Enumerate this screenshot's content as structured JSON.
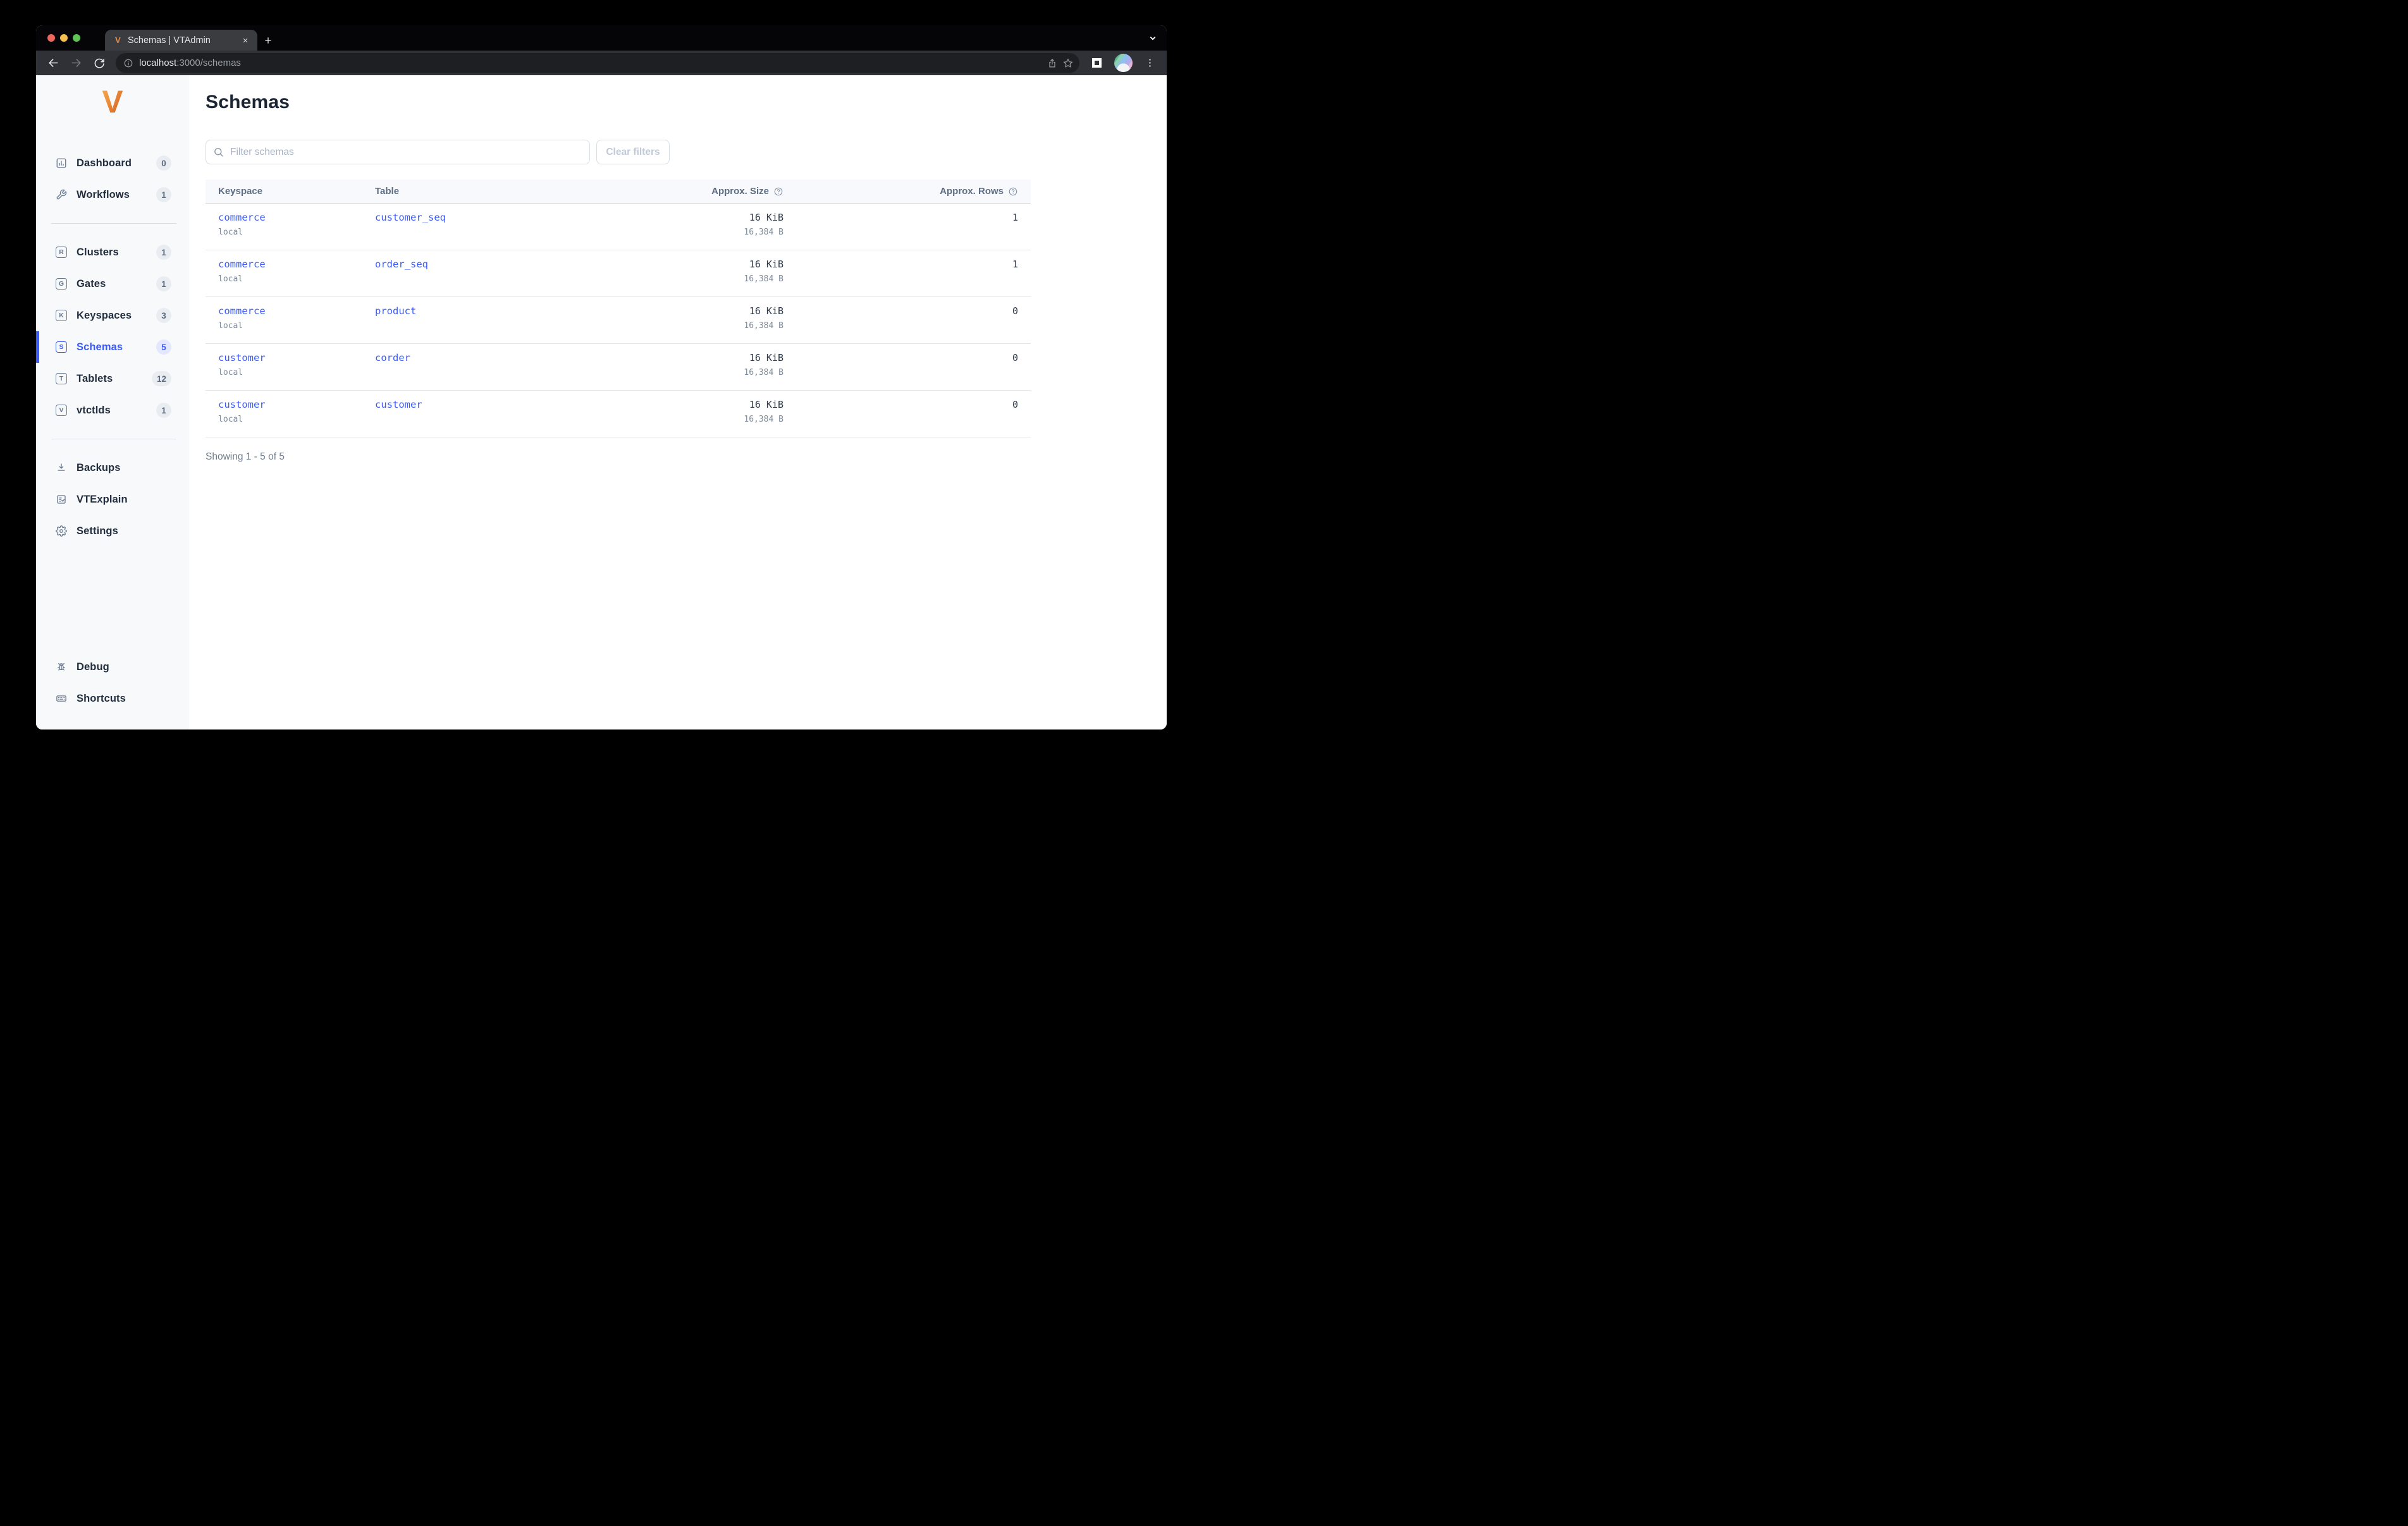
{
  "browser": {
    "tab_title": "Schemas | VTAdmin",
    "url_host": "localhost",
    "url_rest": ":3000/schemas"
  },
  "sidebar": {
    "nav": [
      {
        "label": "Dashboard",
        "badge": "0"
      },
      {
        "label": "Workflows",
        "badge": "1"
      },
      {
        "label": "Clusters",
        "badge": "1",
        "letter": "R"
      },
      {
        "label": "Gates",
        "badge": "1",
        "letter": "G"
      },
      {
        "label": "Keyspaces",
        "badge": "3",
        "letter": "K"
      },
      {
        "label": "Schemas",
        "badge": "5",
        "letter": "S"
      },
      {
        "label": "Tablets",
        "badge": "12",
        "letter": "T"
      },
      {
        "label": "vtctlds",
        "badge": "1",
        "letter": "V"
      }
    ],
    "secondary": [
      {
        "label": "Backups"
      },
      {
        "label": "VTExplain"
      },
      {
        "label": "Settings"
      }
    ],
    "bottom": [
      {
        "label": "Debug"
      },
      {
        "label": "Shortcuts"
      }
    ]
  },
  "main": {
    "title": "Schemas",
    "filter_placeholder": "Filter schemas",
    "clear_button": "Clear filters",
    "table": {
      "headers": {
        "keyspace": "Keyspace",
        "table": "Table",
        "size": "Approx. Size",
        "rows": "Approx. Rows"
      },
      "rows": [
        {
          "keyspace": "commerce",
          "cluster": "local",
          "table": "customer_seq",
          "size": "16 KiB",
          "size_bytes": "16,384 B",
          "rows": "1"
        },
        {
          "keyspace": "commerce",
          "cluster": "local",
          "table": "order_seq",
          "size": "16 KiB",
          "size_bytes": "16,384 B",
          "rows": "1"
        },
        {
          "keyspace": "commerce",
          "cluster": "local",
          "table": "product",
          "size": "16 KiB",
          "size_bytes": "16,384 B",
          "rows": "0"
        },
        {
          "keyspace": "customer",
          "cluster": "local",
          "table": "corder",
          "size": "16 KiB",
          "size_bytes": "16,384 B",
          "rows": "0"
        },
        {
          "keyspace": "customer",
          "cluster": "local",
          "table": "customer",
          "size": "16 KiB",
          "size_bytes": "16,384 B",
          "rows": "0"
        }
      ],
      "footer": "Showing 1 - 5 of 5"
    }
  },
  "colors": {
    "accent": "#3c5cfa",
    "link": "#3b5bfc",
    "logo_orange_light": "#f6ad55",
    "logo_orange": "#ed8936",
    "logo_orange_dark": "#c05621",
    "sidebar_bg": "#f8f9fb",
    "table_header_bg": "#f7f9fc"
  }
}
